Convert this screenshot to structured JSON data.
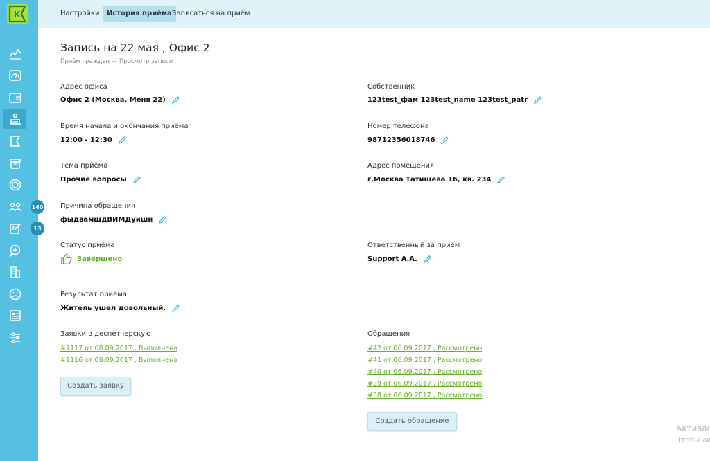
{
  "sidebar": {
    "logo_letter": "K",
    "badges": [
      "140",
      "13"
    ]
  },
  "nav": {
    "tabs": [
      "Настройки",
      "История приёма",
      "Записаться на приём"
    ],
    "active": 1
  },
  "page": {
    "title": "Запись на 22 мая , Офис 2",
    "breadcrumb_link": "Приём граждан",
    "breadcrumb_sep": " — ",
    "breadcrumb_current": "Просмотр записи"
  },
  "fields": {
    "office_address": {
      "label": "Адрес офиса",
      "value": "Офис 2 (Москва, Меня 22)"
    },
    "owner": {
      "label": "Собственник",
      "value": "123test_фам 123test_name 123test_patr"
    },
    "time": {
      "label": "Время начала и окончания приёма",
      "value": "12:00 - 12:30"
    },
    "phone": {
      "label": "Номер телефона",
      "value": "98712356018746"
    },
    "topic": {
      "label": "Тема приёма",
      "value": "Прочие вопросы"
    },
    "premises_address": {
      "label": "Адрес помещения",
      "value": "г.Москва Татищева 16, кв. 234"
    },
    "reason": {
      "label": "Причина обращения",
      "value": "фыдвамщдВИМДуишн"
    },
    "status": {
      "label": "Статус приёма",
      "value": "Завершено"
    },
    "responsible": {
      "label": "Ответственный за приём",
      "value": "Support А.А."
    },
    "result": {
      "label": "Результат приёма",
      "value": "Житель ушел довольный."
    }
  },
  "dispatch": {
    "label": "Заявки в деспетчерскую",
    "items": [
      "#1117 от 08.09.2017 , Выполнена",
      "#1116 от 08.09.2017 , Выполнена"
    ],
    "button": "Создать заявку"
  },
  "appeals": {
    "label": "Обращения",
    "items": [
      "#42 от 06.09.2017 , Рассмотрено",
      "#41 от 06.09.2017 , Рассмотрено",
      "#40 от 06.09.2017 , Рассмотрено",
      "#39 от 06.09.2017 , Рассмотрено",
      "#38 от 06.09.2017 , Рассмотрено"
    ],
    "button": "Создать обращение"
  },
  "watermark": {
    "line1": "Активац",
    "line2": "Чтобы акт"
  },
  "colors": {
    "sidebar": "#56c0e3",
    "topbar": "#dff4f9",
    "link": "#6bb128",
    "status_ok": "#60b21f",
    "logo": "#a8df3a"
  }
}
